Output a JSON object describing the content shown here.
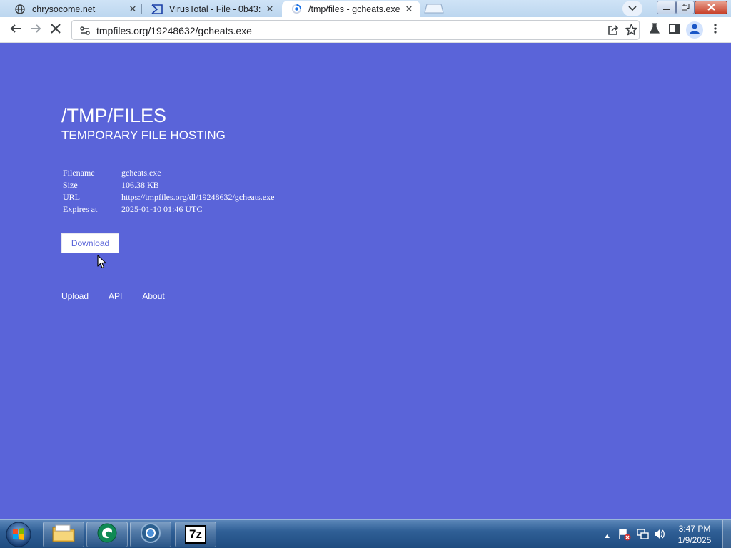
{
  "browser": {
    "tabs": [
      {
        "title": "chrysocome.net",
        "icon": "globe-icon",
        "active": false
      },
      {
        "title": "VirusTotal - File - 0b43:",
        "icon": "virustotal-icon",
        "active": false
      },
      {
        "title": "/tmp/files - gcheats.exe",
        "icon": "loading-spinner-icon",
        "active": true
      }
    ],
    "close_glyph": "✕",
    "url": "tmpfiles.org/19248632/gcheats.exe"
  },
  "page": {
    "title": "/TMP/FILES",
    "subtitle": "TEMPORARY FILE HOSTING",
    "info": [
      {
        "key": "Filename",
        "value": "gcheats.exe"
      },
      {
        "key": "Size",
        "value": "106.38 KB"
      },
      {
        "key": "URL",
        "value": "https://tmpfiles.org/dl/19248632/gcheats.exe"
      },
      {
        "key": "Expires at",
        "value": "2025-01-10 01:46 UTC"
      }
    ],
    "download_label": "Download",
    "footer_links": [
      "Upload",
      "API",
      "About"
    ]
  },
  "taskbar": {
    "apps": [
      "file-explorer-icon",
      "green-app-icon",
      "chrome-icon",
      "7zip-icon"
    ],
    "sevenzip_label": "7z",
    "time": "3:47 PM",
    "date": "1/9/2025"
  },
  "colors": {
    "page_background": "#5a64d9",
    "taskbar": "#2f5f96"
  }
}
